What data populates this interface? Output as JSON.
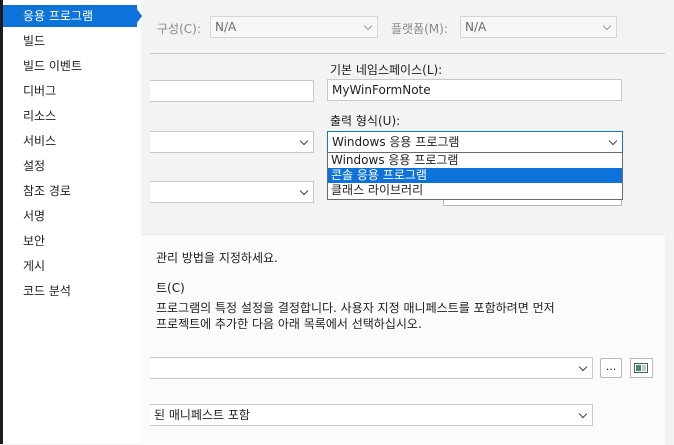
{
  "sidebar": {
    "items": [
      {
        "label": "응용 프로그램",
        "selected": true
      },
      {
        "label": "빌드"
      },
      {
        "label": "빌드 이벤트"
      },
      {
        "label": "디버그"
      },
      {
        "label": "리소스"
      },
      {
        "label": "서비스"
      },
      {
        "label": "설정"
      },
      {
        "label": "참조 경로"
      },
      {
        "label": "서명"
      },
      {
        "label": "보안"
      },
      {
        "label": "게시"
      },
      {
        "label": "코드 분석"
      }
    ]
  },
  "topbar": {
    "config_label": "구성(C):",
    "config_value": "N/A",
    "platform_label": "플랫폼(M):",
    "platform_value": "N/A"
  },
  "form": {
    "namespace_label": "기본 네임스페이스(L):",
    "namespace_value": "MyWinFormNote",
    "output_label": "출력 형식(U):",
    "output_value": "Windows 응용 프로그램",
    "output_options": [
      "Windows 응용 프로그램",
      "콘솔 응용 프로그램",
      "클래스 라이브러리"
    ]
  },
  "resources": {
    "desc": "관리 방법을 지정하세요.",
    "manifest_heading": "트(C)",
    "manifest_desc_1": "프로그램의 특정 설정을 결정합니다. 사용자 지정 매니페스트를 포함하려면 먼저",
    "manifest_desc_2": "프로젝트에 추가한 다음 아래 목록에서 선택하십시오.",
    "browse_label": "...",
    "manifest_select_value": "된 매니페스트 포함"
  },
  "colors": {
    "accent": "#0e73d8",
    "sidebar_bg": "#ffffff",
    "page_bg": "#f3f3f3"
  }
}
